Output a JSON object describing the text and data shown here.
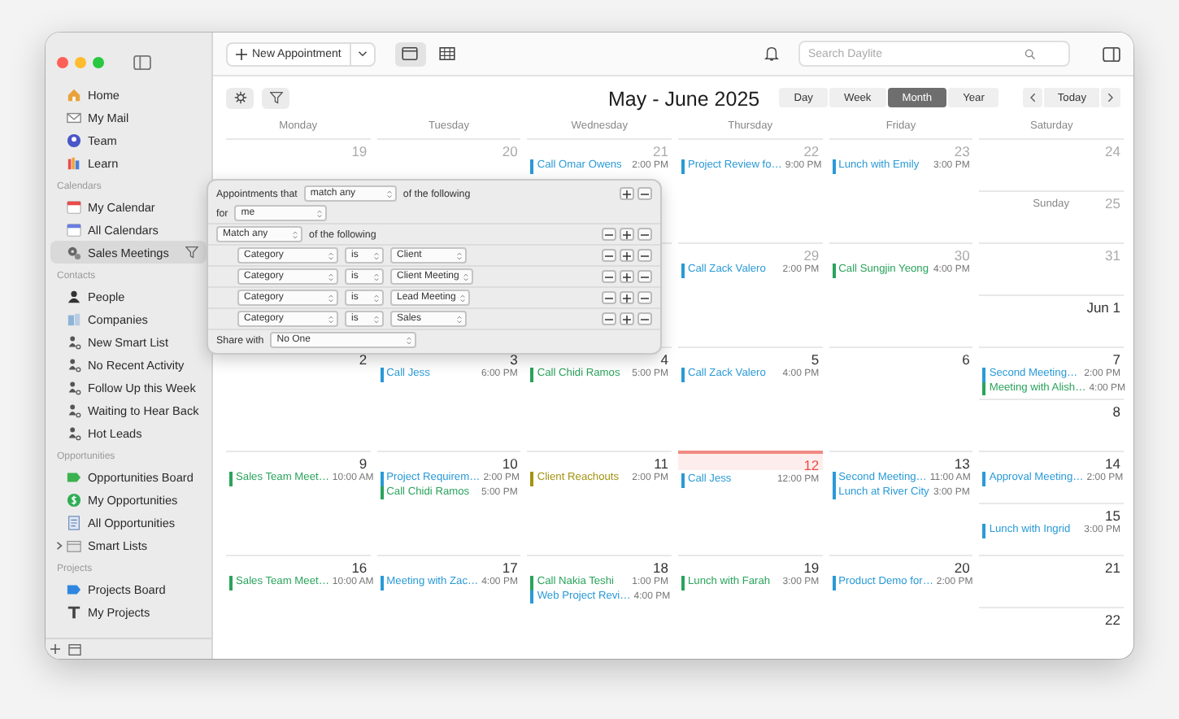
{
  "sidebar": {
    "sections": [
      {
        "items": [
          {
            "label": "Home",
            "kind": "home",
            "selected": false
          },
          {
            "label": "My Mail",
            "kind": "mail",
            "selected": false
          },
          {
            "label": "Team",
            "kind": "team",
            "selected": false
          },
          {
            "label": "Learn",
            "kind": "learn",
            "selected": false
          }
        ]
      },
      {
        "title": "Calendars",
        "items": [
          {
            "label": "My Calendar",
            "kind": "calendar",
            "selected": false
          },
          {
            "label": "All Calendars",
            "kind": "calendars",
            "selected": false
          },
          {
            "label": "Sales Meetings",
            "kind": "meetings",
            "selected": true,
            "filtered": true
          }
        ]
      },
      {
        "title": "Contacts",
        "items": [
          {
            "label": "People",
            "kind": "person",
            "selected": false
          },
          {
            "label": "Companies",
            "kind": "company",
            "selected": false
          },
          {
            "label": "New Smart List",
            "kind": "smart-list",
            "selected": false
          },
          {
            "label": "No Recent Activity",
            "kind": "smart-list",
            "selected": false
          },
          {
            "label": "Follow Up this Week",
            "kind": "smart-list",
            "selected": false
          },
          {
            "label": "Waiting to Hear Back",
            "kind": "smart-list",
            "selected": false
          },
          {
            "label": "Hot Leads",
            "kind": "smart-list",
            "selected": false
          }
        ]
      },
      {
        "title": "Opportunities",
        "items": [
          {
            "label": "Opportunities Board",
            "kind": "board",
            "selected": false
          },
          {
            "label": "My Opportunities",
            "kind": "money",
            "selected": false
          },
          {
            "label": "All Opportunities",
            "kind": "list",
            "selected": false
          },
          {
            "label": "Smart Lists",
            "kind": "folder",
            "selected": false,
            "expanded": false
          }
        ]
      },
      {
        "title": "Projects",
        "items": [
          {
            "label": "Projects Board",
            "kind": "project-board",
            "selected": false
          },
          {
            "label": "My Projects",
            "kind": "project",
            "selected": false
          }
        ]
      }
    ]
  },
  "toolbar": {
    "new_button": "New Appointment",
    "views": [
      {
        "kind": "calendar",
        "selected": true
      },
      {
        "kind": "grid",
        "selected": false
      }
    ],
    "search": {
      "placeholder": "Search Daylite"
    }
  },
  "header": {
    "title": "May - June 2025",
    "ranges": [
      {
        "label": "Day",
        "selected": false
      },
      {
        "label": "Week",
        "selected": false
      },
      {
        "label": "Month",
        "selected": true
      },
      {
        "label": "Year",
        "selected": false
      }
    ],
    "today_button": "Today"
  },
  "weekdays": [
    "Monday",
    "Tuesday",
    "Wednesday",
    "Thursday",
    "Friday",
    "Saturday"
  ],
  "weeks": [
    {
      "days": [
        {
          "date": "19",
          "muted": true
        },
        {
          "date": "20",
          "muted": true
        },
        {
          "date": "21",
          "muted": true,
          "events": [
            {
              "title": "Call Omar Owens",
              "time": "2:00 PM",
              "color": "#2a9ad6"
            }
          ]
        },
        {
          "date": "22",
          "muted": true,
          "events": [
            {
              "title": "Project Review fo…",
              "time": "9:00 PM",
              "color": "#2a9ad6"
            }
          ]
        },
        {
          "date": "23",
          "muted": true,
          "events": [
            {
              "title": "Lunch with Emily",
              "time": "3:00 PM",
              "color": "#2a9ad6"
            }
          ]
        }
      ],
      "weekend": [
        {
          "date": "24",
          "muted": true
        },
        {
          "label": "Sunday",
          "date": "25",
          "muted": true
        }
      ]
    },
    {
      "days": [
        {
          "date": "29",
          "muted": true,
          "events": [
            {
              "title": "Call Zack Valero",
              "time": "2:00 PM",
              "color": "#2a9ad6"
            }
          ]
        },
        {
          "date": "30",
          "muted": true,
          "events": [
            {
              "title": "Call Sungjin Yeong",
              "time": "4:00 PM",
              "color": "#2aa35c"
            }
          ]
        }
      ],
      "weekend": [
        {
          "date": "31",
          "muted": true
        },
        {
          "date": "Jun 1",
          "muted": false
        }
      ]
    },
    {
      "days": [
        {
          "date": "2",
          "muted": false
        },
        {
          "date": "3",
          "muted": false,
          "events": [
            {
              "title": "Call Jess",
              "time": "6:00 PM",
              "color": "#2a9ad6"
            }
          ]
        },
        {
          "date": "4",
          "muted": false,
          "events": [
            {
              "title": "Call Chidi Ramos",
              "time": "5:00 PM",
              "color": "#2aa35c"
            }
          ]
        },
        {
          "date": "5",
          "muted": false,
          "events": [
            {
              "title": "Call Zack Valero",
              "time": "4:00 PM",
              "color": "#2a9ad6"
            }
          ]
        },
        {
          "date": "6",
          "muted": false
        }
      ],
      "weekend": [
        {
          "date": "7",
          "muted": false,
          "events": [
            {
              "title": "Second Meeting…",
              "time": "2:00 PM",
              "color": "#2a9ad6"
            },
            {
              "title": "Meeting with Alish…",
              "time": "4:00 PM",
              "color": "#2aa35c"
            }
          ]
        },
        {
          "date": "8",
          "muted": false
        }
      ]
    },
    {
      "days": [
        {
          "date": "9",
          "muted": false,
          "events": [
            {
              "title": "Sales Team Meet…",
              "time": "10:00 AM",
              "color": "#2aa35c"
            }
          ]
        },
        {
          "date": "10",
          "muted": false,
          "events": [
            {
              "title": "Project Requirem…",
              "time": "2:00 PM",
              "color": "#2a9ad6"
            },
            {
              "title": "Call Chidi Ramos",
              "time": "5:00 PM",
              "color": "#2aa35c"
            }
          ]
        },
        {
          "date": "11",
          "muted": false,
          "events": [
            {
              "title": "Client Reachouts",
              "time": "2:00 PM",
              "color": "#a39312"
            }
          ]
        },
        {
          "date": "12",
          "muted": false,
          "today": true,
          "events": [
            {
              "title": "Call Jess",
              "time": "12:00 PM",
              "color": "#2a9ad6"
            }
          ]
        },
        {
          "date": "13",
          "muted": false,
          "events": [
            {
              "title": "Second Meeting…",
              "time": "11:00 AM",
              "color": "#2a9ad6"
            },
            {
              "title": "Lunch at River City",
              "time": "3:00 PM",
              "color": "#2a9ad6"
            }
          ]
        }
      ],
      "weekend": [
        {
          "date": "14",
          "muted": false,
          "events": [
            {
              "title": "Approval Meeting…",
              "time": "2:00 PM",
              "color": "#2a9ad6"
            }
          ]
        },
        {
          "date": "15",
          "muted": false,
          "events": [
            {
              "title": "Lunch with Ingrid",
              "time": "3:00 PM",
              "color": "#2a9ad6"
            }
          ]
        }
      ]
    },
    {
      "days": [
        {
          "date": "16",
          "muted": false,
          "events": [
            {
              "title": "Sales Team Meet…",
              "time": "10:00 AM",
              "color": "#2aa35c"
            }
          ]
        },
        {
          "date": "17",
          "muted": false,
          "events": [
            {
              "title": "Meeting with Zac…",
              "time": "4:00 PM",
              "color": "#2a9ad6"
            }
          ]
        },
        {
          "date": "18",
          "muted": false,
          "events": [
            {
              "title": "Call Nakia Teshi",
              "time": "1:00 PM",
              "color": "#2aa35c"
            },
            {
              "title": "Web Project Revi…",
              "time": "4:00 PM",
              "color": "#2a9ad6"
            }
          ]
        },
        {
          "date": "19",
          "muted": false,
          "events": [
            {
              "title": "Lunch with Farah",
              "time": "3:00 PM",
              "color": "#2aa35c"
            }
          ]
        },
        {
          "date": "20",
          "muted": false,
          "events": [
            {
              "title": "Product Demo for…",
              "time": "2:00 PM",
              "color": "#2a9ad6"
            }
          ]
        }
      ],
      "weekend": [
        {
          "date": "21",
          "muted": false
        },
        {
          "date": "22",
          "muted": false
        }
      ]
    }
  ],
  "filter_popup": {
    "head": {
      "lead": "Appointments that",
      "select": "match any",
      "tail": "of the following"
    },
    "for_row": {
      "label": "for",
      "select": "me"
    },
    "group": {
      "select": "Match any",
      "tail": "of the following"
    },
    "criteria": [
      {
        "field": "Category",
        "operator": "is",
        "value": "Client"
      },
      {
        "field": "Category",
        "operator": "is",
        "value": "Client Meeting"
      },
      {
        "field": "Category",
        "operator": "is",
        "value": "Lead Meeting"
      },
      {
        "field": "Category",
        "operator": "is",
        "value": "Sales"
      }
    ],
    "share": {
      "label": "Share with",
      "select": "No One"
    }
  }
}
